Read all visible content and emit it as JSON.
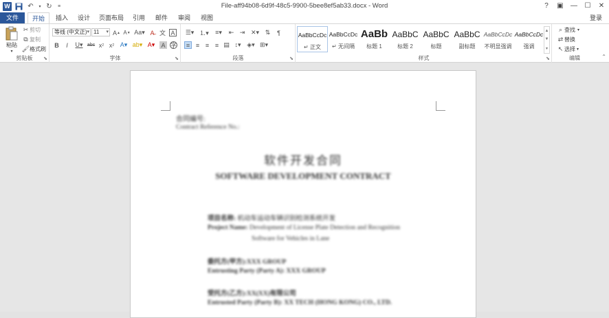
{
  "window": {
    "title": "File-aff94b08-6d9f-48c5-9900-5bee8ef5ab33.docx - Word",
    "help": "?",
    "controls": [
      "▣",
      "—",
      "☐",
      "✕"
    ],
    "login": "登录"
  },
  "tabs": {
    "file": "文件",
    "home": "开始",
    "insert": "插入",
    "design": "设计",
    "layout": "页面布局",
    "references": "引用",
    "mailings": "邮件",
    "review": "审阅",
    "view": "视图"
  },
  "clipboard": {
    "paste": "粘贴",
    "cut": "剪切",
    "copy": "复制",
    "format_painter": "格式刷",
    "label": "剪贴板"
  },
  "font": {
    "name": "等线 (中文正)",
    "size": "11",
    "label": "字体"
  },
  "paragraph": {
    "label": "段落"
  },
  "styles": {
    "label": "样式",
    "items": [
      {
        "preview": "AaBbCcDc",
        "name": "↵ 正文"
      },
      {
        "preview": "AaBbCcDc",
        "name": "↵ 无间隔"
      },
      {
        "preview": "AaBb",
        "name": "标题 1"
      },
      {
        "preview": "AaBbC",
        "name": "标题 2"
      },
      {
        "preview": "AaBbC",
        "name": "标题"
      },
      {
        "preview": "AaBbC",
        "name": "副标题"
      },
      {
        "preview": "AaBbCcDc",
        "name": "不明显强调"
      },
      {
        "preview": "AaBbCcDc",
        "name": "强调"
      }
    ]
  },
  "editing": {
    "find": "查找",
    "replace": "替换",
    "select": "选择",
    "label": "编辑"
  },
  "document": {
    "line1": "合同编号:",
    "line2": "Contract Reference No.:",
    "title_cn": "软件开发合同",
    "title_en": "SOFTWARE DEVELOPMENT CONTRACT",
    "project_cn_label": "项目名称:",
    "project_cn": "机动车运动车辆识别检测系统开发",
    "project_en_label": "Project Name:",
    "project_en_1": "Development of License Plate Detection and Recognition",
    "project_en_2": "Software for Vehicles in Lane",
    "party_a_cn": "委托方(甲方):XXX GROUP",
    "party_a_en": "Entrusting Party (Party A): XXX GROUP",
    "party_b_cn": "受托方(乙方):XX(XX)有限公司",
    "party_b_en": "Entrusted Party (Party B): XX TECH (HONG KONG) CO., LTD."
  }
}
